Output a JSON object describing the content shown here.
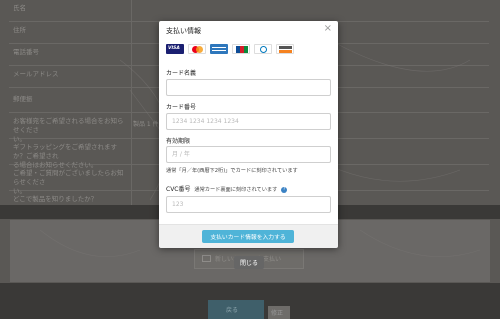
{
  "background": {
    "rows": [
      {
        "label": "氏名"
      },
      {
        "label": "住所"
      },
      {
        "label": "電話番号"
      },
      {
        "label": "メールアドレス"
      },
      {
        "label": "郵便振"
      }
    ],
    "questions": [
      {
        "label_1": "お客様宛をご希望される場合をお知らせくださ",
        "label_2": "い。",
        "value": "製品 1 件"
      },
      {
        "label_1": "ギフトラッピングをご希望されますか？ご希望され",
        "label_2": "る場合はお知らせください。",
        "value": ""
      },
      {
        "label_1": "ご希望・ご質問がございましたらお知らせくださ",
        "label_2": "い。",
        "value": ""
      },
      {
        "label_1": "どこで製品を知りましたか？",
        "label_2": "",
        "value": ""
      }
    ],
    "pay_button_label": "新しいカードでお支払い",
    "back_button_label": "戻る",
    "back2_label": "修正"
  },
  "modal": {
    "title": "支払い情報",
    "close_glyph": "×",
    "card_brands": [
      "VISA",
      "Mastercard",
      "AMEX",
      "JCB",
      "Diners",
      "DISCOVER"
    ],
    "card_name": {
      "label": "カード名義",
      "value": "",
      "placeholder": ""
    },
    "card_number": {
      "label": "カード番号",
      "value": "",
      "placeholder": "1234 1234 1234 1234"
    },
    "expiry": {
      "label": "有効期限",
      "value": "",
      "placeholder": "月 / 年",
      "hint": "通常「月／年(西暦下2桁)」でカードに刻印されています"
    },
    "cvc": {
      "label": "CVC番号",
      "label_note": "通常カード裏面に刻印されています",
      "value": "",
      "placeholder": "123"
    },
    "submit_label": "支払いカード情報を入力する",
    "close_label": "閉じる"
  },
  "colors": {
    "accent": "#4fb4d8",
    "overlay": "#5a5855",
    "help": "#3b82c4"
  }
}
